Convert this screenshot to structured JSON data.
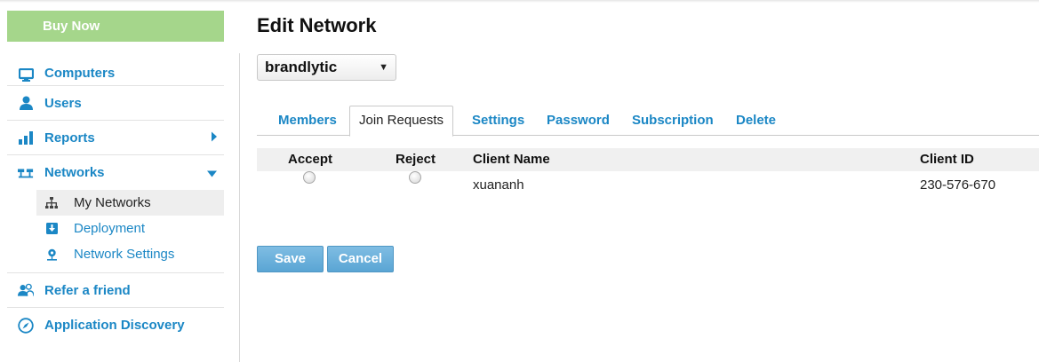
{
  "sidebar": {
    "buy_now": "Buy Now",
    "items": [
      {
        "label": "Computers",
        "icon": "monitor-icon"
      },
      {
        "label": "Users",
        "icon": "user-icon"
      },
      {
        "label": "Reports",
        "icon": "bar-chart-icon"
      },
      {
        "label": "Networks",
        "icon": "network-icon"
      },
      {
        "label": "Refer a friend",
        "icon": "refer-friend-icon"
      },
      {
        "label": "Application Discovery",
        "icon": "compass-icon"
      }
    ],
    "networks_sub": [
      {
        "label": "My Networks",
        "icon": "network-tree-icon",
        "active": true
      },
      {
        "label": "Deployment",
        "icon": "download-icon"
      },
      {
        "label": "Network Settings",
        "icon": "network-settings-icon"
      }
    ]
  },
  "main": {
    "title": "Edit Network",
    "network_select": {
      "value": "brandlytic"
    },
    "tabs": [
      {
        "label": "Members"
      },
      {
        "label": "Join Requests",
        "active": true
      },
      {
        "label": "Settings"
      },
      {
        "label": "Password"
      },
      {
        "label": "Subscription"
      },
      {
        "label": "Delete"
      }
    ],
    "table": {
      "headers": [
        "Accept",
        "Reject",
        "Client Name",
        "Client ID"
      ],
      "rows": [
        {
          "client_name": "xuananh",
          "client_id": "230-576-670",
          "accept": false,
          "reject": false
        }
      ]
    },
    "buttons": {
      "save": "Save",
      "cancel": "Cancel"
    }
  },
  "colors": {
    "link": "#1b87c5",
    "buy_now": "#a5d68b",
    "button": "#5aa5d4"
  }
}
